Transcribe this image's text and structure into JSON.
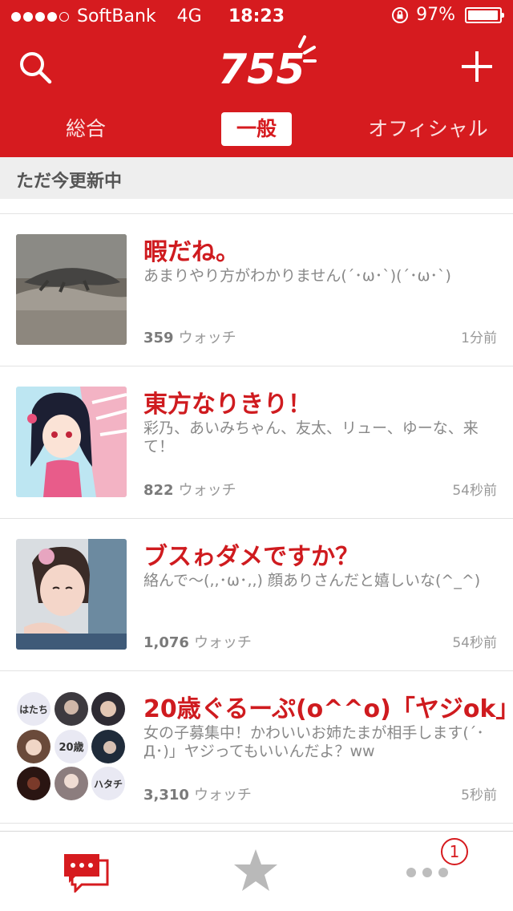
{
  "status_bar": {
    "carrier": "SoftBank",
    "network": "4G",
    "time": "18:23",
    "battery": "97%",
    "battery_level": 0.97,
    "signal_bars": 4
  },
  "nav": {
    "search_icon": "search-icon",
    "logo": "755",
    "add_icon": "plus-icon"
  },
  "tabs": [
    {
      "label": "総合",
      "active": false
    },
    {
      "label": "一般",
      "active": true
    },
    {
      "label": "オフィシャル",
      "active": false
    }
  ],
  "section_header": "ただ今更新中",
  "rooms": [
    {
      "title": "暇だね。",
      "description": "あまりやり方がわかりません(´･ω･`)(´･ω･`)",
      "watch_count": "359",
      "watch_label": "ウォッチ",
      "updated": "1分前"
    },
    {
      "title": "東方なりきり！",
      "description": "彩乃、あいみちゃん、友太、リュー、ゆーな、来て！",
      "watch_count": "822",
      "watch_label": "ウォッチ",
      "updated": "54秒前"
    },
    {
      "title": "ブスゎダメですか？",
      "description": "絡んで〜(,,･ω･,,) 顔ありさんだと嬉しいな(^_^)",
      "watch_count": "1,076",
      "watch_label": "ウォッチ",
      "updated": "54秒前"
    },
    {
      "title": "20歳ぐるーぷ(o^^o)「ヤジok」",
      "description": "女の子募集中！かわいいお姉たまが相手します(´･Д･)」ヤジってもいいんだよ？ww",
      "watch_count": "3,310",
      "watch_label": "ウォッチ",
      "updated": "5秒前"
    }
  ],
  "collage_labels": {
    "a": "はたち",
    "b": "20歳",
    "c": "ハタチ"
  },
  "tab_bar": {
    "items": [
      "chat-icon",
      "star-icon",
      "more-icon"
    ],
    "badge": "1"
  },
  "colors": {
    "brand_red": "#d61b1f"
  }
}
